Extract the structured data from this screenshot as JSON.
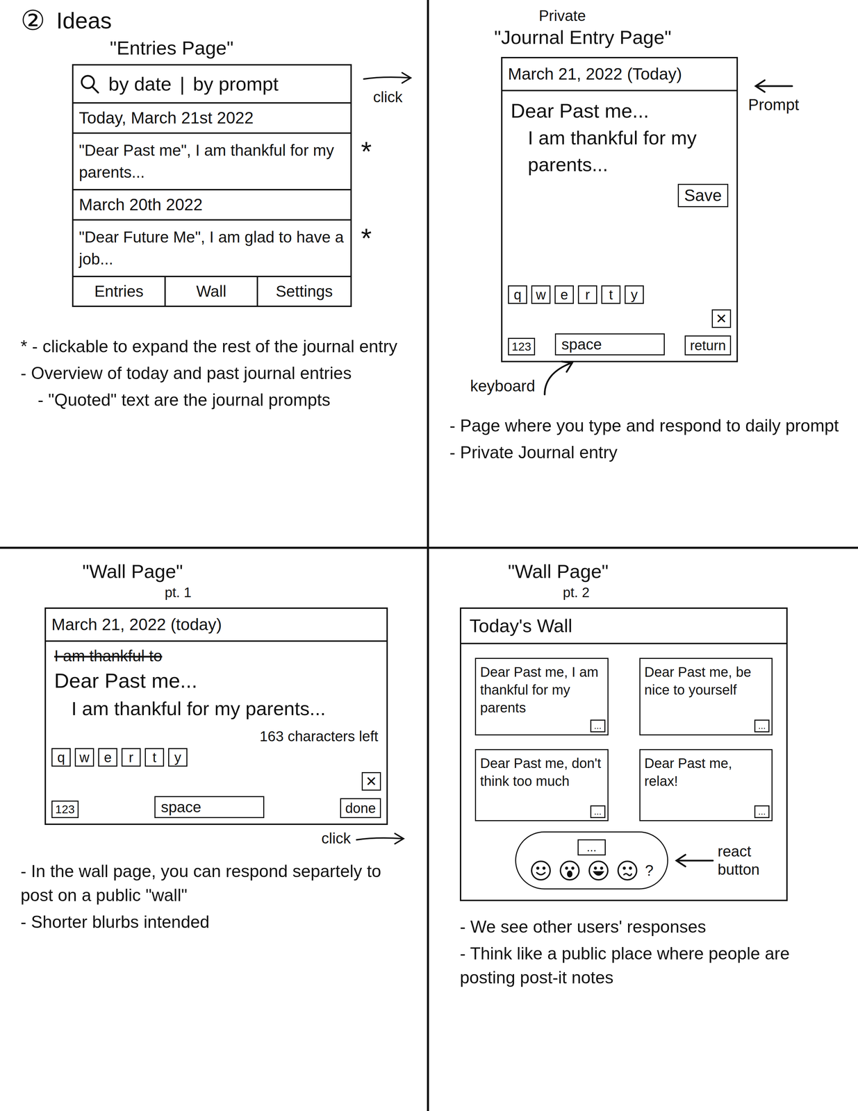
{
  "title": {
    "number": "②",
    "text": "Ideas"
  },
  "entries_page": {
    "heading": "\"Entries Page\"",
    "search": {
      "filters": [
        "by date",
        "by prompt"
      ],
      "separator": "|"
    },
    "entries": [
      {
        "date": "Today, March 21st 2022",
        "text": "\"Dear Past me\", I am thankful for my parents...",
        "mark": "*"
      },
      {
        "date": "March 20th 2022",
        "text": "\"Dear Future Me\", I am glad to have a job...",
        "mark": "*"
      }
    ],
    "nav": [
      {
        "label": "Entries"
      },
      {
        "label": "Wall"
      },
      {
        "label": "Settings"
      }
    ],
    "click_label": "click",
    "notes": [
      {
        "text": "* - clickable to expand the rest of the journal entry",
        "kind": "main"
      },
      {
        "text": "- Overview of today and past journal entries",
        "kind": "main"
      },
      {
        "text": "- \"Quoted\" text are the journal prompts",
        "kind": "sub"
      }
    ]
  },
  "journal_page": {
    "label": "Private",
    "heading": "\"Journal Entry Page\"",
    "date": "March 21, 2022 (Today)",
    "prompt": "Dear Past me...",
    "body": "I am thankful for my parents...",
    "save": "Save",
    "keys": [
      "q",
      "w",
      "e",
      "r",
      "t",
      "y"
    ],
    "delete_key": "✕",
    "bottom_keys": [
      "123",
      "space",
      "return"
    ],
    "prompt_annotation": "Prompt",
    "keyboard_annotation": "keyboard",
    "notes": [
      {
        "text": "- Page where you type and respond to daily prompt",
        "kind": "main"
      },
      {
        "text": "- Private Journal entry",
        "kind": "main"
      }
    ]
  },
  "wall_compose": {
    "heading": "\"Wall Page\"",
    "part": "pt. 1",
    "date": "March 21, 2022 (today)",
    "struck": "I am thankful to",
    "prompt": "Dear Past me...",
    "body": "I am thankful for my parents...",
    "counter": "163 characters left",
    "keys": [
      "q",
      "w",
      "e",
      "r",
      "t",
      "y"
    ],
    "delete_key": "✕",
    "bottom_keys": [
      "123",
      "space",
      "done"
    ],
    "click_label": "click",
    "notes": [
      {
        "text": "- In the wall page, you can respond separtely to post on a public \"wall\"",
        "kind": "main"
      },
      {
        "text": "- Shorter blurbs intended",
        "kind": "main"
      }
    ]
  },
  "wall_board": {
    "heading": "\"Wall Page\"",
    "part": "pt. 2",
    "title": "Today's Wall",
    "posts": [
      {
        "text": "Dear Past me, I am thankful for my parents"
      },
      {
        "text": "Dear Past me, be nice to yourself"
      },
      {
        "text": "Dear Past me, don't think too much"
      },
      {
        "text": "Dear Past me, relax!"
      }
    ],
    "react_label": "...",
    "react_annotation": "react button",
    "more_reactions": "?",
    "notes": [
      {
        "text": "- We see other users' responses",
        "kind": "main"
      },
      {
        "text": "- Think like a public place where people are posting post-it notes",
        "kind": "main"
      }
    ]
  }
}
